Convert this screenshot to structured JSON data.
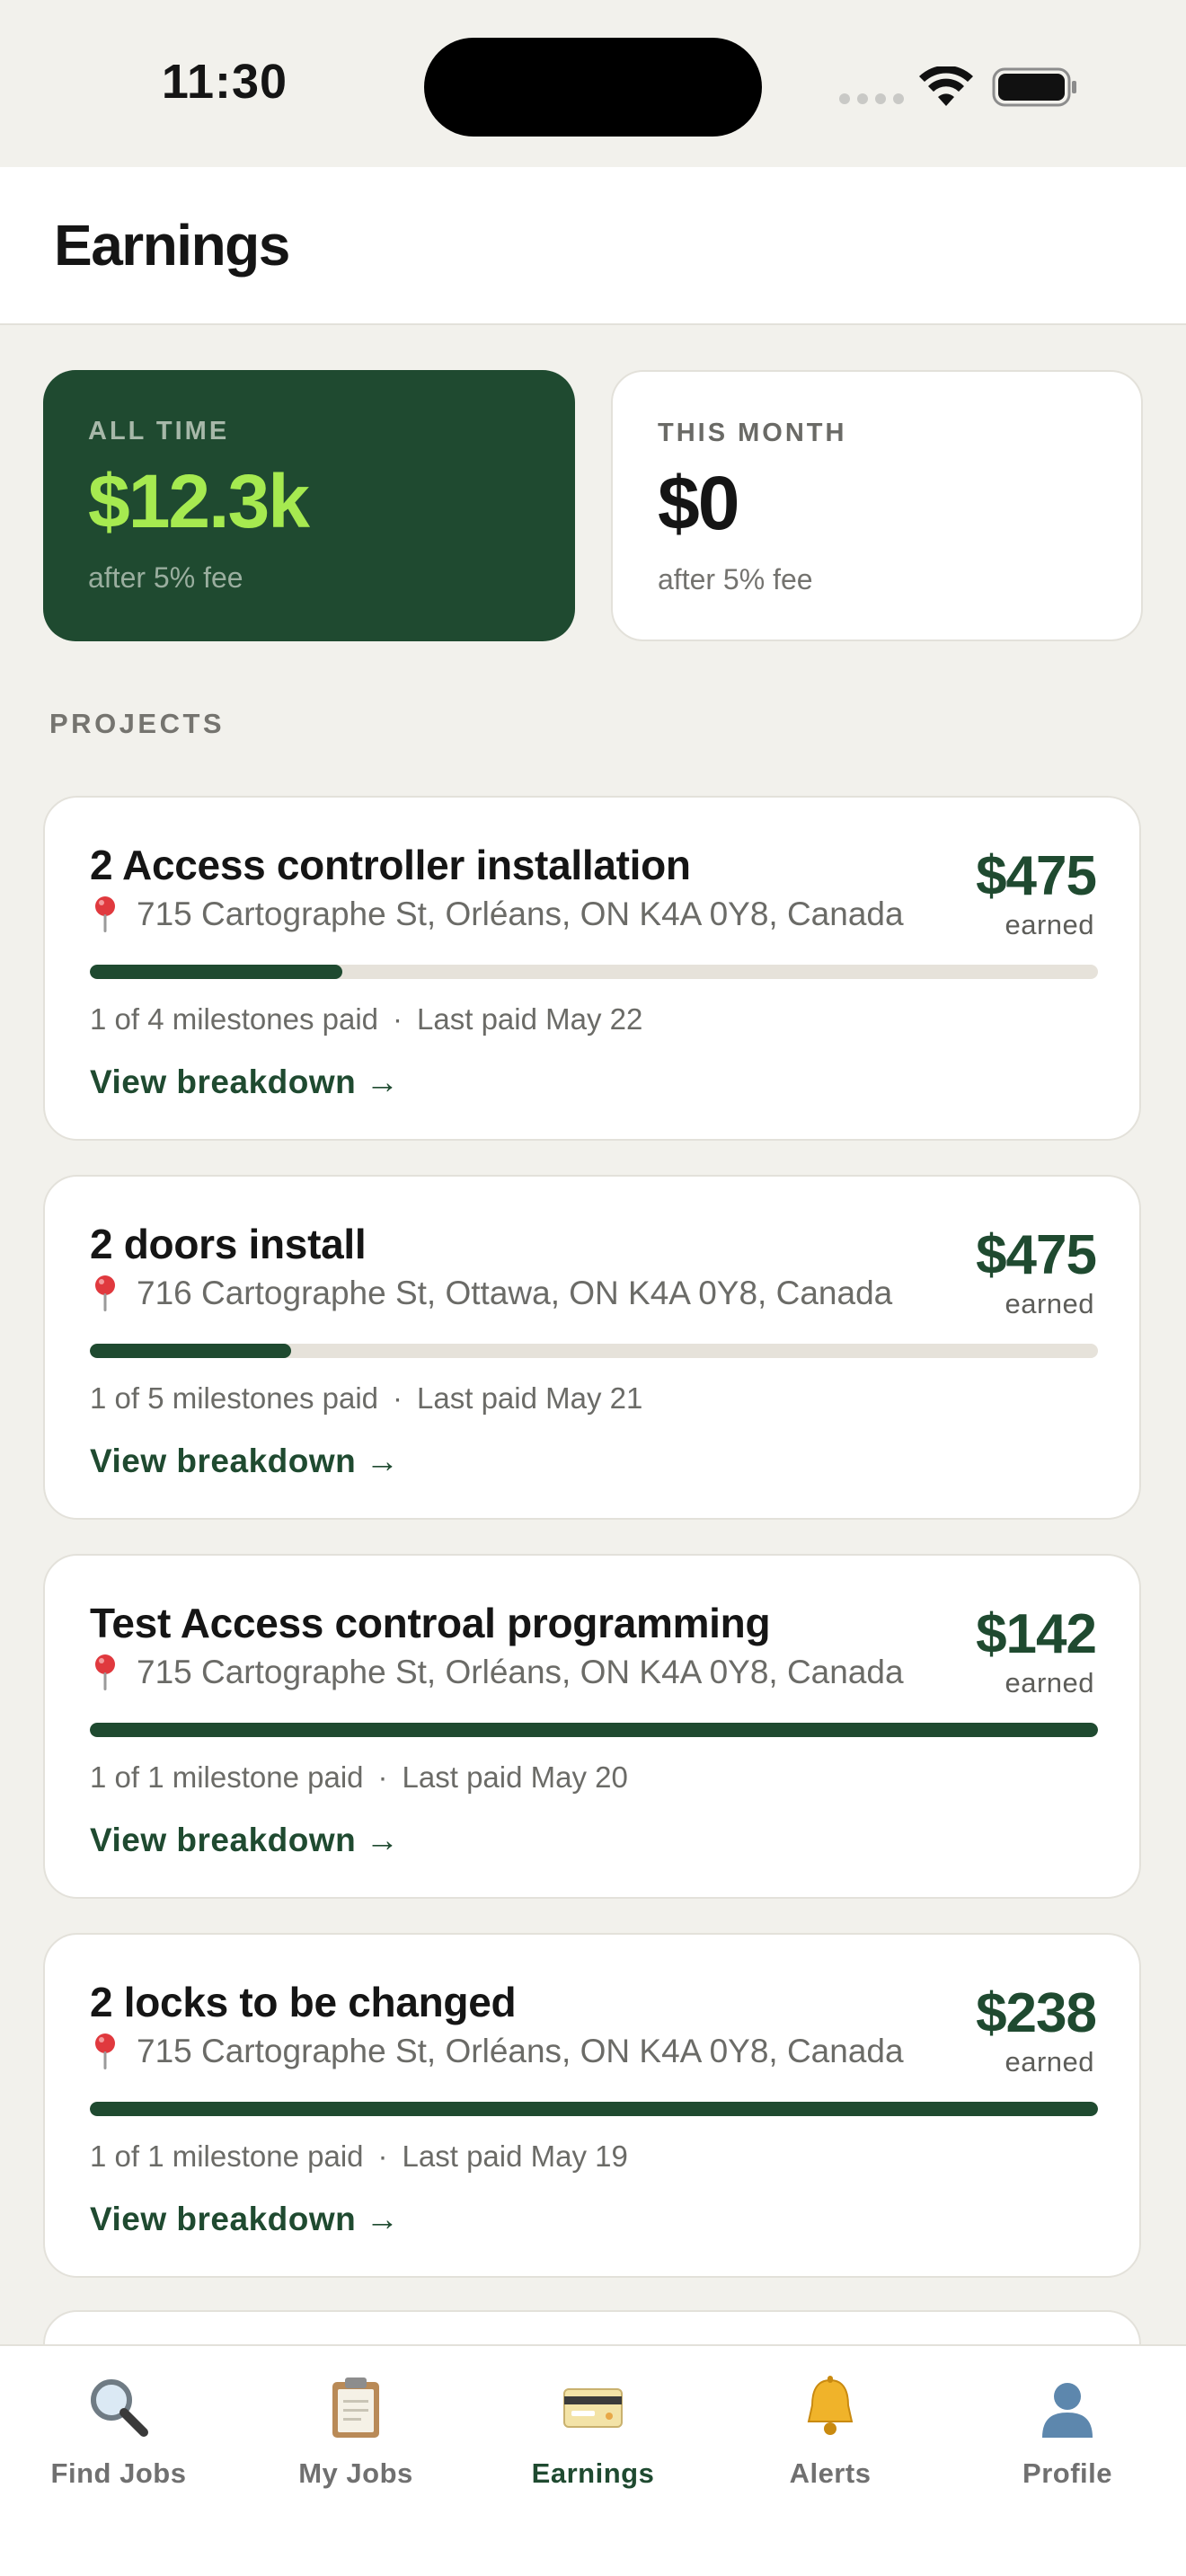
{
  "status_bar": {
    "time": "11:30"
  },
  "header": {
    "title": "Earnings"
  },
  "summary": {
    "all_time": {
      "label": "ALL TIME",
      "value": "$12.3k",
      "sub": "after 5% fee"
    },
    "this_month": {
      "label": "THIS MONTH",
      "value": "$0",
      "sub": "after 5% fee"
    }
  },
  "section": {
    "projects_label": "PROJECTS"
  },
  "projects": [
    {
      "title": "2 Access controller installation",
      "address": "715 Cartographe St, Orléans, ON K4A 0Y8, Canada",
      "amount": "$475",
      "earned_label": "earned",
      "progress": 0.25,
      "milestones": "1 of 4 milestones paid",
      "last_paid": "Last paid May 22",
      "link": "View breakdown →"
    },
    {
      "title": "2 doors install",
      "address": "716 Cartographe St, Ottawa, ON K4A 0Y8, Canada",
      "amount": "$475",
      "earned_label": "earned",
      "progress": 0.2,
      "milestones": "1 of 5 milestones paid",
      "last_paid": "Last paid May 21",
      "link": "View breakdown →"
    },
    {
      "title": "Test Access controal programming",
      "address": "715 Cartographe St, Orléans, ON K4A 0Y8, Canada",
      "amount": "$142",
      "earned_label": "earned",
      "progress": 1.0,
      "milestones": "1 of 1 milestone paid",
      "last_paid": "Last paid May 20",
      "link": "View breakdown →"
    },
    {
      "title": "2 locks to be changed",
      "address": "715 Cartographe St, Orléans, ON K4A 0Y8, Canada",
      "amount": "$238",
      "earned_label": "earned",
      "progress": 1.0,
      "milestones": "1 of 1 milestone paid",
      "last_paid": "Last paid May 19",
      "link": "View breakdown →"
    }
  ],
  "tabs": [
    {
      "label": "Find Jobs",
      "icon": "magnifier-icon",
      "active": false
    },
    {
      "label": "My Jobs",
      "icon": "clipboard-icon",
      "active": false
    },
    {
      "label": "Earnings",
      "icon": "credit-card-icon",
      "active": true
    },
    {
      "label": "Alerts",
      "icon": "bell-icon",
      "active": false
    },
    {
      "label": "Profile",
      "icon": "person-icon",
      "active": false
    }
  ],
  "colors": {
    "brand_green": "#1f4a30",
    "accent_lime": "#a6ea50",
    "background": "#f2f1ec"
  },
  "separator": "·"
}
